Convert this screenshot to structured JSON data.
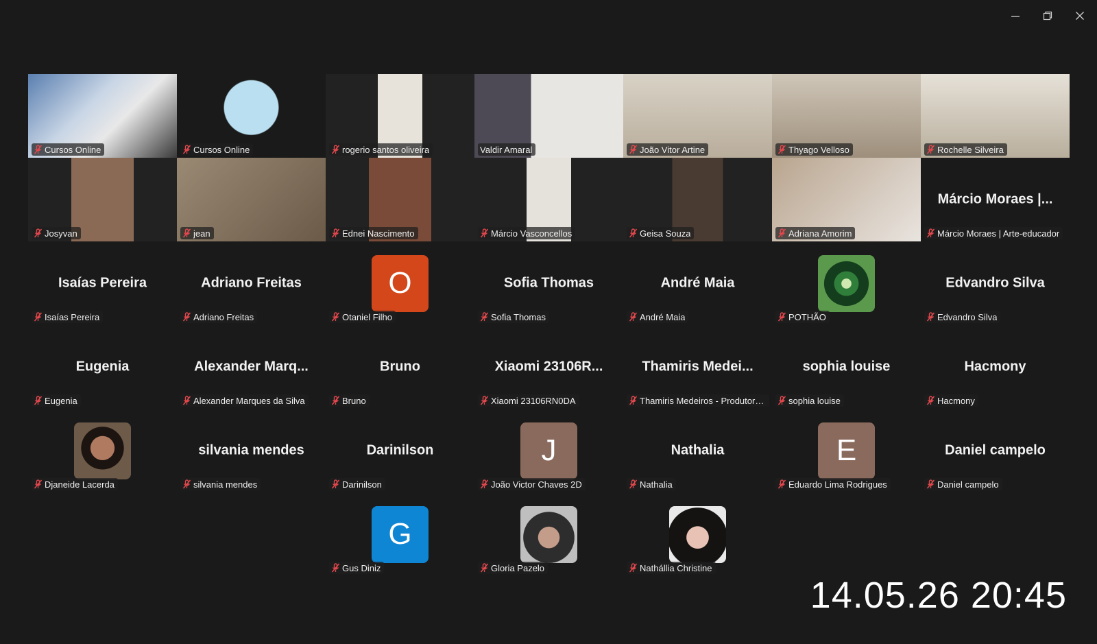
{
  "window": {
    "minimize_icon": "minimize-icon",
    "restore_icon": "restore-icon",
    "close_icon": "close-icon"
  },
  "colors": {
    "background": "#1a1a1a",
    "speaking_border": "#22c55e",
    "muted_mic": "#e5484d"
  },
  "participants": [
    {
      "label": "Cursos Online",
      "video": true,
      "speaking": true
    },
    {
      "label": "Cursos Online",
      "video": true
    },
    {
      "label": "rogerio santos oliveira",
      "video": true
    },
    {
      "label": "Valdir Amaral",
      "video": true,
      "muted": false
    },
    {
      "label": "João Vitor Artine",
      "video": true
    },
    {
      "label": "Thyago Velloso",
      "video": true
    },
    {
      "label": "Rochelle Silveira",
      "video": true
    },
    {
      "label": "Josyvan",
      "video": true
    },
    {
      "label": "jean",
      "video": true
    },
    {
      "label": "Ednei Nascimento",
      "video": true
    },
    {
      "label": "Márcio Vasconcellos",
      "video": true
    },
    {
      "label": "Geisa Souza",
      "video": true
    },
    {
      "label": "Adriana Amorim",
      "video": true
    },
    {
      "label": "Márcio Moraes | Arte-educador",
      "display_name": "Márcio Moraes |..."
    },
    {
      "label": "Isaías Pereira",
      "display_name": "Isaías Pereira"
    },
    {
      "label": "Adriano Freitas",
      "display_name": "Adriano Freitas"
    },
    {
      "label": "Otaniel Filho",
      "avatar_letter": "O",
      "avatar_color": "#d4471b"
    },
    {
      "label": "Sofia Thomas",
      "display_name": "Sofia Thomas"
    },
    {
      "label": "André Maia",
      "display_name": "André Maia"
    },
    {
      "label": "POTHÃO",
      "avatar_image": "green-eye"
    },
    {
      "label": "Edvandro Silva",
      "display_name": "Edvandro Silva"
    },
    {
      "label": "Eugenia",
      "display_name": "Eugenia"
    },
    {
      "label": "Alexander Marques da Silva",
      "display_name": "Alexander  Marq..."
    },
    {
      "label": "Bruno",
      "display_name": "Bruno"
    },
    {
      "label": "Xiaomi 23106RN0DA",
      "display_name": "Xiaomi  23106R..."
    },
    {
      "label": "Thamiris Medeiros - Produtora ...",
      "display_name": "Thamiris  Medei..."
    },
    {
      "label": "sophia louise",
      "display_name": "sophia louise"
    },
    {
      "label": "Hacmony",
      "display_name": "Hacmony"
    },
    {
      "label": "Djaneide Lacerda",
      "avatar_image": "photo-woman"
    },
    {
      "label": "silvania mendes",
      "display_name": "silvania mendes"
    },
    {
      "label": "Darinilson",
      "display_name": "Darinilson"
    },
    {
      "label": "João Victor Chaves 2D",
      "avatar_letter": "J",
      "avatar_color": "#8b6a5e"
    },
    {
      "label": "Nathalia",
      "display_name": "Nathalia"
    },
    {
      "label": "Eduardo Lima Rodrigues",
      "avatar_letter": "E",
      "avatar_color": "#8b6a5e"
    },
    {
      "label": "Daniel campelo",
      "display_name": "Daniel campelo"
    },
    {
      "label": "Gus Diniz",
      "avatar_letter": "G",
      "avatar_color": "#0e86d4",
      "col": 2
    },
    {
      "label": "Gloria Pazelo",
      "avatar_image": "photo-car",
      "col": 3
    },
    {
      "label": "Nathállia Christine",
      "avatar_image": "photo-dark-hair",
      "col": 4
    }
  ],
  "timestamp": "14.05.26 20:45"
}
